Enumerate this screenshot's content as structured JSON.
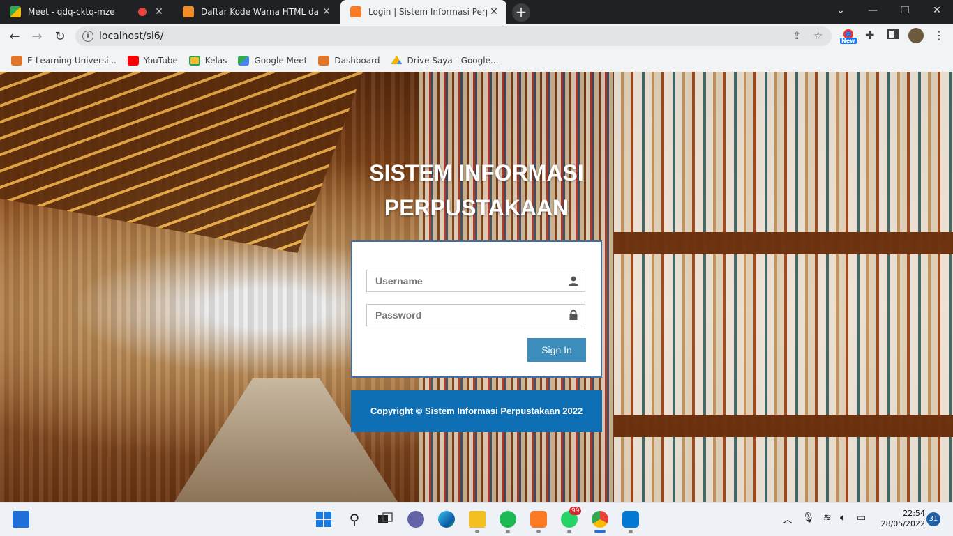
{
  "browser": {
    "tabs": [
      {
        "title": "Meet - qdq-cktq-mze",
        "favicon": "google-meet-icon",
        "recording": true,
        "active": false
      },
      {
        "title": "Daftar Kode Warna HTML dan CSS",
        "favicon": "js-site-icon",
        "active": false
      },
      {
        "title": "Login | Sistem Informasi Perpustakaan",
        "favicon": "xampp-icon",
        "active": true
      }
    ],
    "new_tab": "+",
    "url": "localhost/si6/",
    "extension_badge": "New",
    "bookmarks": [
      {
        "label": "E-Learning Universi...",
        "icon": "elearning-icon"
      },
      {
        "label": "YouTube",
        "icon": "youtube-icon"
      },
      {
        "label": "Kelas",
        "icon": "classroom-icon"
      },
      {
        "label": "Google Meet",
        "icon": "google-meet-icon"
      },
      {
        "label": "Dashboard",
        "icon": "elearning-icon"
      },
      {
        "label": "Drive Saya - Google...",
        "icon": "google-drive-icon"
      }
    ]
  },
  "login": {
    "title_line1": "SISTEM INFORMASI",
    "title_line2": "PERPUSTAKAAN",
    "username_placeholder": "Username",
    "password_placeholder": "Password",
    "signin_label": "Sign In",
    "copyright": "Copyright © Sistem Informasi Perpustakaan 2022"
  },
  "taskbar": {
    "apps": [
      "windows-start-icon",
      "search-icon",
      "task-view-icon",
      "teams-chat-icon",
      "edge-icon",
      "file-explorer-icon",
      "spotify-icon",
      "xampp-icon",
      "whatsapp-icon",
      "chrome-icon",
      "vscode-icon"
    ],
    "whatsapp_badge": "99",
    "time": "22:54",
    "date": "28/05/2022",
    "notifications": "31"
  }
}
